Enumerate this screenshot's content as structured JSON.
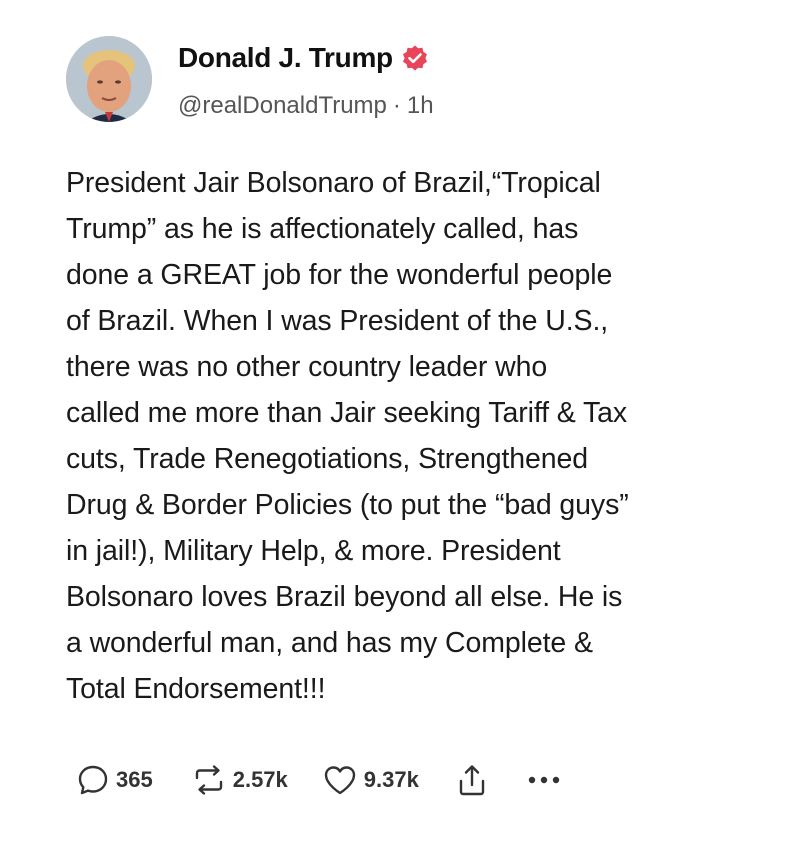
{
  "author": {
    "display_name": "Donald J. Trump",
    "handle": "@realDonaldTrump",
    "separator": "·",
    "timestamp": "1h",
    "verified_icon": "verified-badge-icon",
    "verified_color": "#e8445a"
  },
  "post": {
    "text": "President Jair Bolsonaro of Brazil,“Tropical\nTrump” as he is affectionately called, has\ndone a GREAT job for the wonderful people\nof Brazil. When I was President of the U.S.,\nthere was no other country leader who\ncalled me more than Jair seeking Tariff & Tax\ncuts, Trade Renegotiations, Strengthened\nDrug & Border Policies (to put the “bad guys”\nin jail!), Military Help, & more. President\nBolsonaro loves Brazil beyond all else. He is\na wonderful man, and has my Complete &\nTotal Endorsement!!!"
  },
  "actions": {
    "reply": {
      "icon": "reply-icon",
      "count": "365"
    },
    "repost": {
      "icon": "repost-icon",
      "count": "2.57k"
    },
    "like": {
      "icon": "heart-icon",
      "count": "9.37k"
    },
    "share": {
      "icon": "share-icon"
    },
    "more": {
      "icon": "more-icon"
    }
  },
  "colors": {
    "text": "#1a1a1a",
    "secondary_text": "#555555",
    "icon": "#333333"
  }
}
